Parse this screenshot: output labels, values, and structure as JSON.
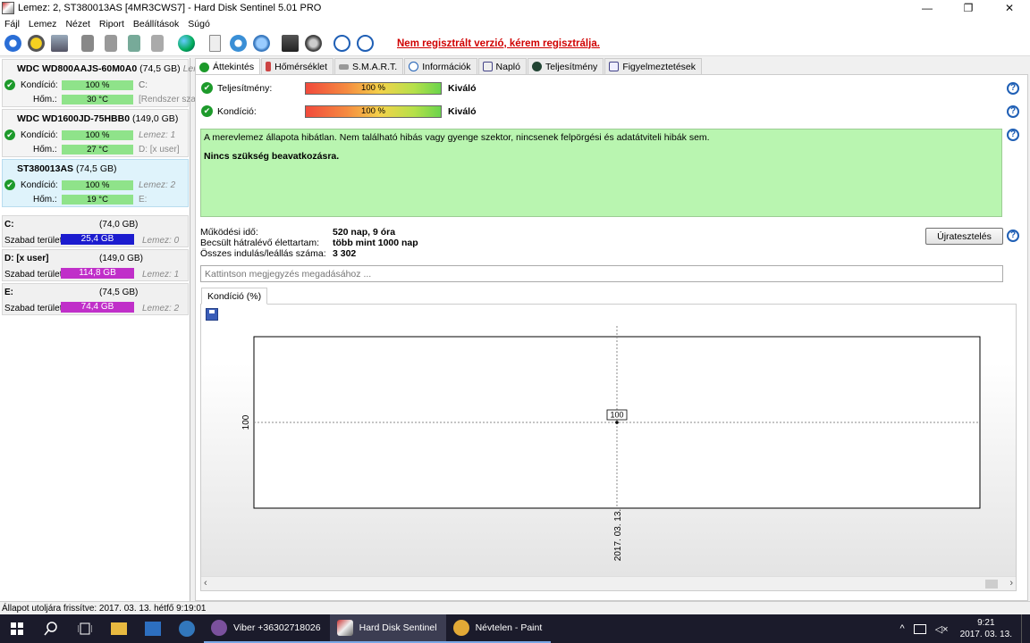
{
  "window": {
    "title": "Lemez: 2, ST380013AS [4MR3CWS7]  -  Hard Disk Sentinel 5.01 PRO",
    "minimize": "—",
    "maximize": "❐",
    "close": "✕"
  },
  "menu": [
    "Fájl",
    "Lemez",
    "Nézet",
    "Riport",
    "Beállítások",
    "Súgó"
  ],
  "toolbar": {
    "promo": "Nem regisztrált verzió, kérem regisztrálja."
  },
  "disks": [
    {
      "name": "WDC WD800AAJS-60M0A0",
      "size": "(74,5 GB)",
      "tail": "Lemez:",
      "cond_label": "Kondíció:",
      "cond_value": "100 %",
      "cond_extra": "C:",
      "temp_label": "Hőm.:",
      "temp_value": "30 °C",
      "temp_extra": "[Rendszer sza"
    },
    {
      "name": "WDC WD1600JD-75HBB0",
      "size": "(149,0 GB)",
      "tail": "",
      "cond_label": "Kondíció:",
      "cond_value": "100 %",
      "cond_extra": "Lemez: 1",
      "temp_label": "Hőm.:",
      "temp_value": "27 °C",
      "temp_extra": "D: [x user]"
    },
    {
      "name": "ST380013AS",
      "size": "(74,5 GB)",
      "tail": "",
      "cond_label": "Kondíció:",
      "cond_value": "100 %",
      "cond_extra": "Lemez: 2",
      "temp_label": "Hőm.:",
      "temp_value": "19 °C",
      "temp_extra": "E:"
    }
  ],
  "volumes": [
    {
      "name": "C:",
      "size": "(74,0 GB)",
      "free_label": "Szabad terület",
      "free": "25,4 GB",
      "disk": "Lemez: 0",
      "color": "#1c1ccf"
    },
    {
      "name": "D: [x user]",
      "size": "(149,0 GB)",
      "free_label": "Szabad terület",
      "free": "114,8 GB",
      "disk": "Lemez: 1",
      "color": "#c02fc9"
    },
    {
      "name": "E:",
      "size": "(74,5 GB)",
      "free_label": "Szabad terület",
      "free": "74,4 GB",
      "disk": "Lemez: 2",
      "color": "#c02fc9"
    }
  ],
  "tabs": [
    "Áttekintés",
    "Hőmérséklet",
    "S.M.A.R.T.",
    "Információk",
    "Napló",
    "Teljesítmény",
    "Figyelmeztetések"
  ],
  "overview": {
    "perf_label": "Teljesítmény:",
    "perf_value": "100 %",
    "perf_result": "Kiváló",
    "cond_label": "Kondíció:",
    "cond_value": "100 %",
    "cond_result": "Kiváló",
    "message": "A merevlemez állapota hibátlan. Nem található hibás vagy gyenge szektor, nincsenek felpörgési és adatátviteli hibák sem.",
    "message_bold": "Nincs szükség beavatkozásra.",
    "uptime_label": "Működési idő:",
    "uptime_value": "520 nap, 9 óra",
    "life_label": "Becsült hátralévő élettartam:",
    "life_value": "több mint 1000 nap",
    "starts_label": "Összes indulás/leállás száma:",
    "starts_value": "3 302",
    "retest_button": "Újratesztelés",
    "note_placeholder": "Kattintson megjegyzés megadásához ...",
    "help": "?"
  },
  "chart_tab": "Kondíció  (%)",
  "chart_data": {
    "type": "line",
    "x": [
      "2017. 03. 13."
    ],
    "series": [
      {
        "values": [
          100
        ]
      }
    ],
    "data_labels": [
      "100"
    ],
    "yticks": [
      "100"
    ],
    "xticks": [
      "2017. 03. 13."
    ]
  },
  "statusbar": "Állapot utoljára frissítve: 2017. 03. 13. hétfő 9:19:01",
  "taskbar": {
    "apps": [
      {
        "label": "Viber +36302718026",
        "color": "#7b519d"
      },
      {
        "label": "Hard Disk Sentinel",
        "color": "#b33"
      },
      {
        "label": "Névtelen - Paint",
        "color": "#e2a936"
      }
    ],
    "time": "9:21",
    "date": "2017. 03. 13."
  }
}
